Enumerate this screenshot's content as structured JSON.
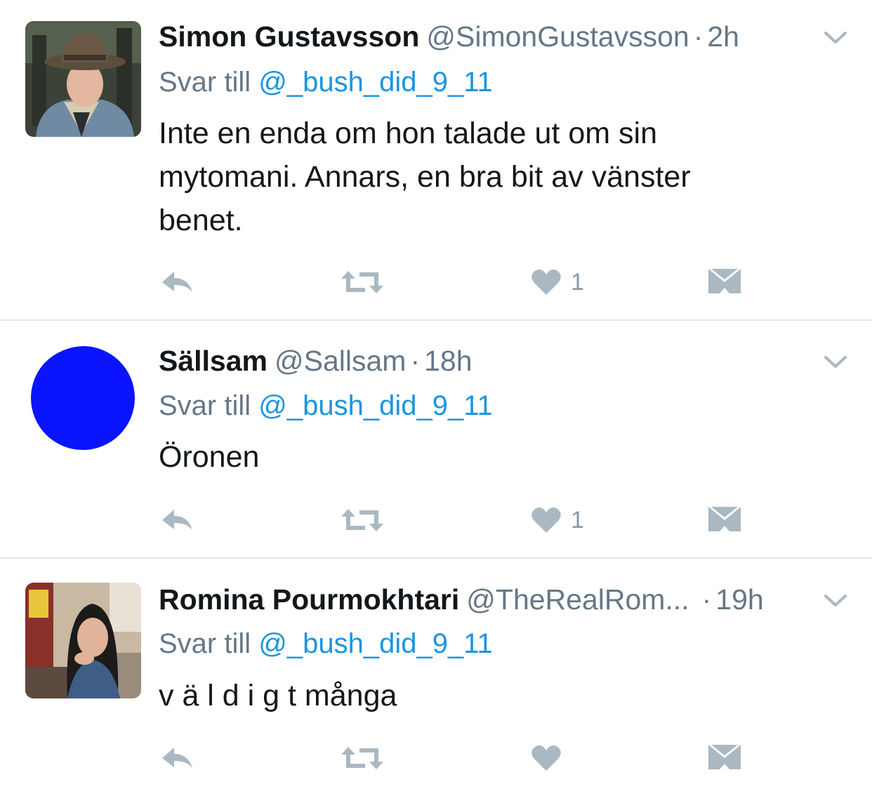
{
  "tweets": [
    {
      "name": "Simon Gustavsson",
      "handle": "@SimonGustavsson",
      "dot": "·",
      "time": "2h",
      "reply_prefix": "Svar till",
      "reply_to": "@_bush_did_9_11",
      "text_lines": [
        "Inte en enda om hon talade ut om sin",
        "mytomani. Annars, en bra bit av vänster",
        "benet."
      ],
      "like_count": "1",
      "avatar": "photo-man-in-hat"
    },
    {
      "name": "Sällsam",
      "handle": "@Sallsam",
      "dot": "·",
      "time": "18h",
      "reply_prefix": "Svar till",
      "reply_to": "@_bush_did_9_11",
      "text_lines": [
        "Öronen"
      ],
      "like_count": "1",
      "avatar": "blue-circle"
    },
    {
      "name": "Romina Pourmokhtari",
      "handle": "@TheRealRom...",
      "dot": "·",
      "time": "19h",
      "reply_prefix": "Svar till",
      "reply_to": "@_bush_did_9_11",
      "text_lines": [
        "v ä l d i g t många"
      ],
      "like_count": "",
      "avatar": "photo-woman-in-cafe"
    }
  ],
  "icons": {
    "reply": "reply-icon",
    "retweet": "retweet-icon",
    "like": "heart-icon",
    "dm": "envelope-icon",
    "menu": "chevron-down-icon"
  },
  "colors": {
    "text": "#14171a",
    "secondary": "#657786",
    "mention": "#1b95e0",
    "icon": "#aab8c2",
    "divider": "#e1e8ed",
    "avatar_blue": "#0a14ff"
  }
}
